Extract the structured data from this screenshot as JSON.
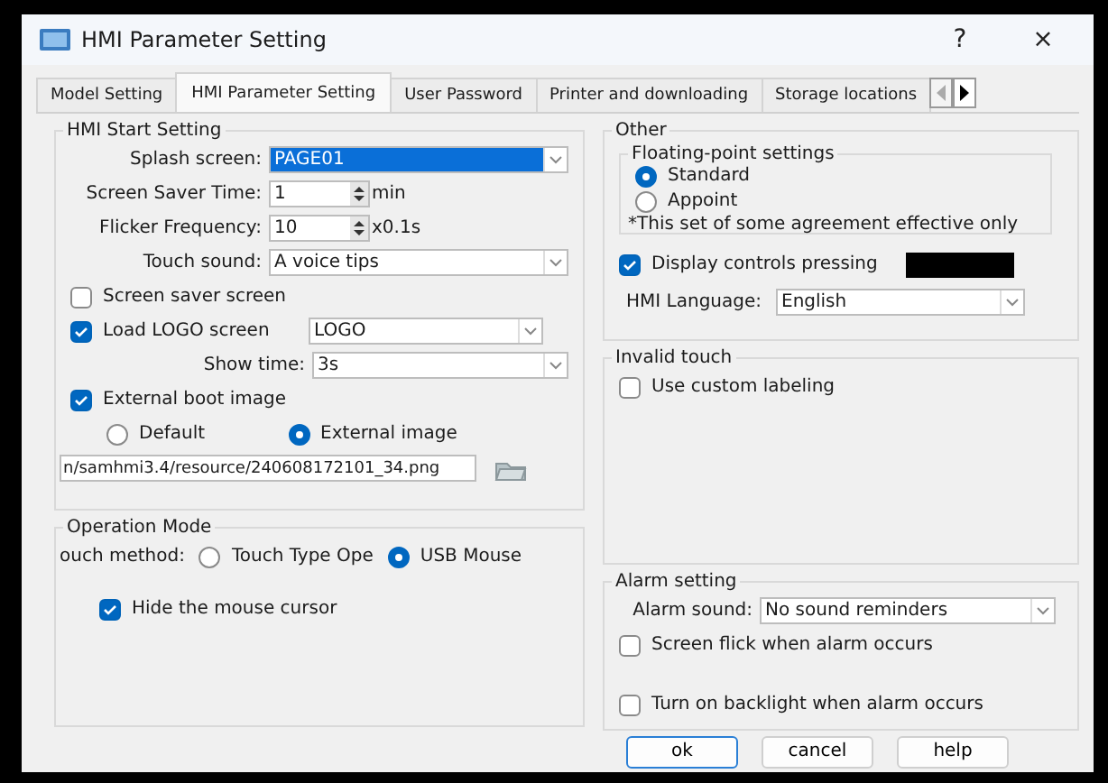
{
  "window": {
    "title": "HMI Parameter Setting",
    "buttons": [
      "?",
      "×"
    ]
  },
  "tabs": [
    {
      "label": "Model Setting",
      "selected": false
    },
    {
      "label": "HMI Parameter Setting",
      "selected": true
    },
    {
      "label": "User Password",
      "selected": false
    },
    {
      "label": "Printer and downloading",
      "selected": false
    },
    {
      "label": "Storage locations",
      "selected": false
    }
  ],
  "tab_scroll": [
    {
      "kind": "left",
      "disabled": true
    },
    {
      "kind": "right",
      "disabled": false
    }
  ],
  "hmi_start_setting": {
    "title": "HMI Start Setting",
    "rows": [
      {
        "kind": "select",
        "label": "Splash screen:",
        "value": "PAGE01",
        "highlighted": true
      },
      {
        "kind": "spin",
        "label": "Screen Saver Time:",
        "value": "1",
        "unit": "min"
      },
      {
        "kind": "spin",
        "label": "Flicker Frequency:",
        "value": "10",
        "unit": "x0.1s"
      },
      {
        "kind": "select",
        "label": "Touch sound:",
        "value": "A voice tips",
        "highlighted": false
      },
      {
        "kind": "check",
        "label": "Screen saver screen",
        "checked": false
      },
      {
        "kind": "check_select",
        "label": "Load LOGO screen",
        "checked": true,
        "value": "LOGO"
      },
      {
        "kind": "select",
        "label": "Show time:",
        "value": "3s",
        "highlighted": false
      },
      {
        "kind": "check",
        "label": "External boot image",
        "checked": true
      },
      {
        "kind": "radios",
        "options": [
          {
            "label": "Default",
            "selected": false
          },
          {
            "label": "External image",
            "selected": true
          }
        ]
      },
      {
        "kind": "path",
        "value": "n/samhmi3.4/resource/240608172101_34.png"
      }
    ]
  },
  "operation_mode": {
    "title": "Operation Mode",
    "touch_method": {
      "label": "ouch method:",
      "options": [
        {
          "label": "Touch Type Ope",
          "selected": false
        },
        {
          "label": "USB Mouse",
          "selected": true
        }
      ]
    },
    "hide_cursor": {
      "label": "Hide the mouse cursor",
      "checked": true
    }
  },
  "other": {
    "title": "Other",
    "floating_point": {
      "title": "Floating-point settings",
      "options": [
        {
          "label": "Standard",
          "selected": true
        },
        {
          "label": "Appoint",
          "selected": false
        }
      ],
      "note": "*This set of some agreement effective only"
    },
    "display_controls": {
      "label": "Display controls pressing",
      "checked": true
    },
    "language": {
      "label": "HMI Language:",
      "value": "English"
    }
  },
  "invalid_touch": {
    "title": "Invalid touch",
    "custom_labeling": {
      "label": "Use custom labeling",
      "checked": false
    }
  },
  "alarm_setting": {
    "title": "Alarm setting",
    "sound": {
      "label": "Alarm sound:",
      "value": "No sound reminders"
    },
    "checks": [
      {
        "label": "Screen flick when alarm occurs",
        "checked": false
      },
      {
        "label": "Turn on backlight when alarm occurs",
        "checked": false
      }
    ]
  },
  "footer_buttons": [
    {
      "label": "ok",
      "default": true
    },
    {
      "label": "cancel",
      "default": false
    },
    {
      "label": "help",
      "default": false
    }
  ]
}
